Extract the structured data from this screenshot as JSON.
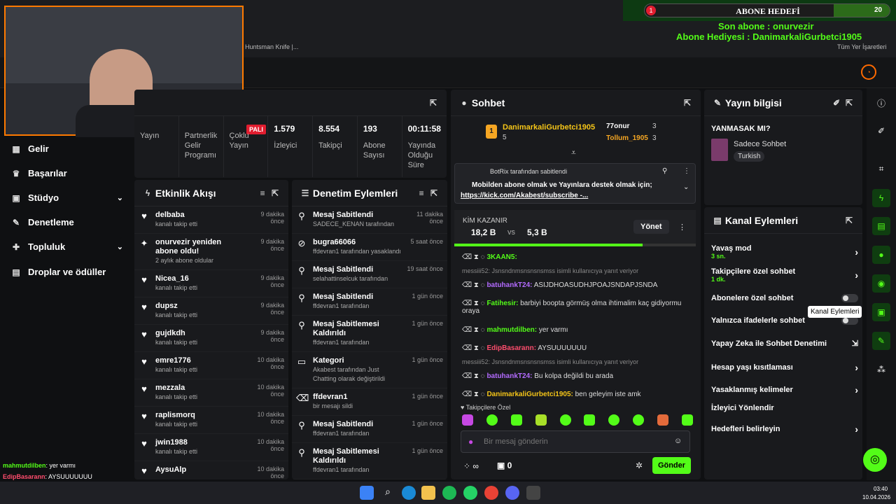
{
  "overlay": {
    "goal_title": "ABONE HEDEFİ",
    "goal_left": "1",
    "goal_right": "20",
    "last_sub": "Son abone : onurvezir",
    "gift_sub": "Abone Hediyesi : DanimarkaliGurbetci1905",
    "bookmark_left": "Huntsman Knife |...",
    "bookmark_right": "Tüm Yer İşaretleri"
  },
  "sidebar": {
    "items": [
      {
        "label": "Gelir"
      },
      {
        "label": "Başarılar"
      },
      {
        "label": "Stüdyo"
      },
      {
        "label": "Denetleme"
      },
      {
        "label": "Topluluk"
      },
      {
        "label": "Droplar ve ödüller"
      }
    ]
  },
  "stats": {
    "badge": "PALI",
    "items": [
      {
        "value": "",
        "label": "Yayın"
      },
      {
        "value": "",
        "label": "Partnerlik Gelir Programı"
      },
      {
        "value": "",
        "label": "Çoklu Yayın"
      },
      {
        "value": "1.579",
        "label": "İzleyici"
      },
      {
        "value": "8.554",
        "label": "Takipçi"
      },
      {
        "value": "193",
        "label": "Abone Sayısı"
      },
      {
        "value": "00:11:58",
        "label": "Yayında Olduğu Süre"
      }
    ]
  },
  "activity": {
    "title": "Etkinlik Akışı",
    "items": [
      {
        "name": "delbaba",
        "desc": "kanalı takip etti",
        "time": "9 dakika önce"
      },
      {
        "name": "onurvezir yeniden abone oldu!",
        "desc": "2 aylık abone oldular",
        "time": "9 dakika önce"
      },
      {
        "name": "Nicea_16",
        "desc": "kanalı takip etti",
        "time": "9 dakika önce"
      },
      {
        "name": "dupsz",
        "desc": "kanalı takip etti",
        "time": "9 dakika önce"
      },
      {
        "name": "gujdkdh",
        "desc": "kanalı takip etti",
        "time": "9 dakika önce"
      },
      {
        "name": "emre1776",
        "desc": "kanalı takip etti",
        "time": "10 dakika önce"
      },
      {
        "name": "mezzala",
        "desc": "kanalı takip etti",
        "time": "10 dakika önce"
      },
      {
        "name": "raplismorq",
        "desc": "kanalı takip etti",
        "time": "10 dakika önce"
      },
      {
        "name": "jwin1988",
        "desc": "kanalı takip etti",
        "time": "10 dakika önce"
      },
      {
        "name": "AysuAlp",
        "desc": "",
        "time": "10 dakika önce"
      }
    ]
  },
  "moderation": {
    "title": "Denetim Eylemleri",
    "items": [
      {
        "name": "Mesaj Sabitlendi",
        "desc": "SADECE_KENAN tarafından",
        "time": "11 dakika önce"
      },
      {
        "name": "bugra66066",
        "desc": "ffdevran1 tarafından yasaklandı",
        "time": "5 saat önce"
      },
      {
        "name": "Mesaj Sabitlendi",
        "desc": "selahattinselcuk tarafından",
        "time": "19 saat önce"
      },
      {
        "name": "Mesaj Sabitlendi",
        "desc": "ffdevran1 tarafından",
        "time": "1 gün önce"
      },
      {
        "name": "Mesaj Sabitlemesi Kaldırıldı",
        "desc": "ffdevran1 tarafından",
        "time": "1 gün önce"
      },
      {
        "name": "Kategori",
        "desc": "Akabest tarafından Just Chatting olarak değiştirildi",
        "time": "1 gün önce"
      },
      {
        "name": "ffdevran1",
        "desc": "bir mesajı sildi",
        "time": "1 gün önce"
      },
      {
        "name": "Mesaj Sabitlendi",
        "desc": "ffdevran1 tarafından",
        "time": "1 gün önce"
      },
      {
        "name": "Mesaj Sabitlemesi Kaldırıldı",
        "desc": "ffdevran1 tarafından",
        "time": "1 gün önce"
      }
    ]
  },
  "chat": {
    "title": "Sohbet",
    "top1": "DanimarkaliGurbetci1905",
    "top1_count": "5",
    "top2": "77onur",
    "top2_count": "3",
    "top3": "Tollum_1905",
    "top3_count": "3",
    "pinned_by": "BotRix tarafından sabitlendi",
    "pinned_msg": "Mobilden abone olmak ve Yayınlara destek olmak için;",
    "pinned_link": "https://kick.com/Akabest/subscribe -...",
    "poll_title": "KİM KAZANIR",
    "poll_a": "18,2 B",
    "poll_vs": "vs",
    "poll_b": "5,3 B",
    "poll_manage": "Yönet",
    "messages": [
      {
        "user": "3KAAN5:",
        "text": "",
        "color": "#53fc18",
        "reply": ""
      },
      {
        "user": "batuhankT24:",
        "text": "ASIJDHOASUDHJPOAJSNDAPJSNDA",
        "color": "#b36bff",
        "reply": "messiii52: Jsnsndnmsnsnsnsmss isimli kullanıcıya yanıt veriyor"
      },
      {
        "user": "Fatihesir:",
        "text": "barbiyi boopta görmüş olma ihtimalim kaç gidiyormu oraya",
        "color": "#53fc18",
        "reply": ""
      },
      {
        "user": "mahmutdilben:",
        "text": "yer varmı",
        "color": "#53fc18",
        "reply": ""
      },
      {
        "user": "EdipBasarann:",
        "text": "AYSUUUUUUU",
        "color": "#ff4d6d",
        "reply": ""
      },
      {
        "user": "batuhankT24:",
        "text": "Bu kolpa değildi bu arada",
        "color": "#b36bff",
        "reply": "messiii52: Jsnsndnmsnsnsnsmss isimli kullanıcıya yanıt veriyor"
      },
      {
        "user": "DanimarkaliGurbetci1905:",
        "text": "ben geleyim iste amk",
        "color": "#f5c518",
        "reply": ""
      }
    ],
    "followers_only": "Takipçilere Özel",
    "input_placeholder": "Bir mesaj gönderin",
    "send": "Gönder",
    "viewers_label": "∞",
    "gift_count": "0"
  },
  "stream_info": {
    "title": "Yayın bilgisi",
    "name": "YANMASAK MI?",
    "category": "Sadece Sohbet",
    "tag": "Turkish"
  },
  "channel_actions": {
    "title": "Kanal Eylemleri",
    "items": [
      {
        "label": "Yavaş mod",
        "sub": "3 sn.",
        "type": "arrow"
      },
      {
        "label": "Takipçilere özel sohbet",
        "sub": "1 dk.",
        "type": "arrow"
      },
      {
        "label": "Abonelere özel sohbet",
        "sub": "",
        "type": "toggle"
      },
      {
        "label": "Yalnızca ifadelerle sohbet",
        "sub": "",
        "type": "toggle"
      },
      {
        "label": "Yapay Zeka ile Sohbet Denetimi",
        "sub": "",
        "type": "ext"
      },
      {
        "label": "Hesap yaşı kısıtlaması",
        "sub": "",
        "type": "arrow"
      },
      {
        "label": "Yasaklanmış kelimeler",
        "sub": "",
        "type": "arrow"
      },
      {
        "label": "İzleyici Yönlendir",
        "sub": "",
        "type": "none"
      },
      {
        "label": "Hedefleri belirleyin",
        "sub": "",
        "type": "arrow"
      }
    ],
    "tooltip": "Kanal Eylemleri"
  },
  "overlay_chat": [
    {
      "user": "mahmutdilben",
      "text": ": yer varmı",
      "color": "#53fc18"
    },
    {
      "user": "EdipBasarann",
      "text": ": AYSUUUUUUU",
      "color": "#ff4d6d"
    },
    {
      "user": "batuhankT24",
      "text": ": Bu kolpa değildi bu arada",
      "color": "#b36bff"
    },
    {
      "user": "DanimarkaliGurbetci1905",
      "text": ": ben geleyim iste amk",
      "color": "#f5c518"
    }
  ],
  "taskbar": {
    "time": "03:40",
    "date": "10.04.2026"
  }
}
